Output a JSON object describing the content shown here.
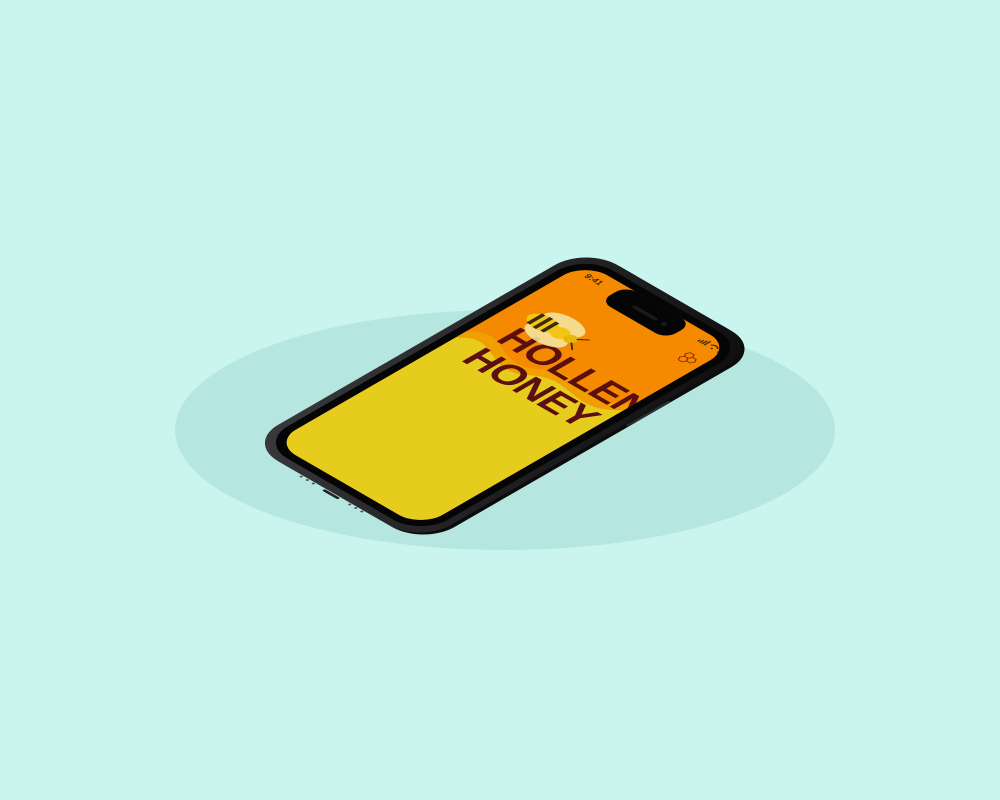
{
  "status_bar": {
    "time": "9:41"
  },
  "app": {
    "title_line_1": "HOLLENBECK",
    "title_line_2": "HONEY"
  },
  "icons": {
    "status_signal": "cellular-signal-icon",
    "status_wifi": "wifi-icon",
    "status_battery": "battery-icon",
    "brand_mark": "honeycomb-icon",
    "hero_image": "bee-icon"
  },
  "colors": {
    "background": "#c9f5ee",
    "screen_yellow": "#e6cc1c",
    "screen_orange": "#f58a00",
    "title_text": "#5b0f0f",
    "device_frame": "#1d1d1f"
  }
}
